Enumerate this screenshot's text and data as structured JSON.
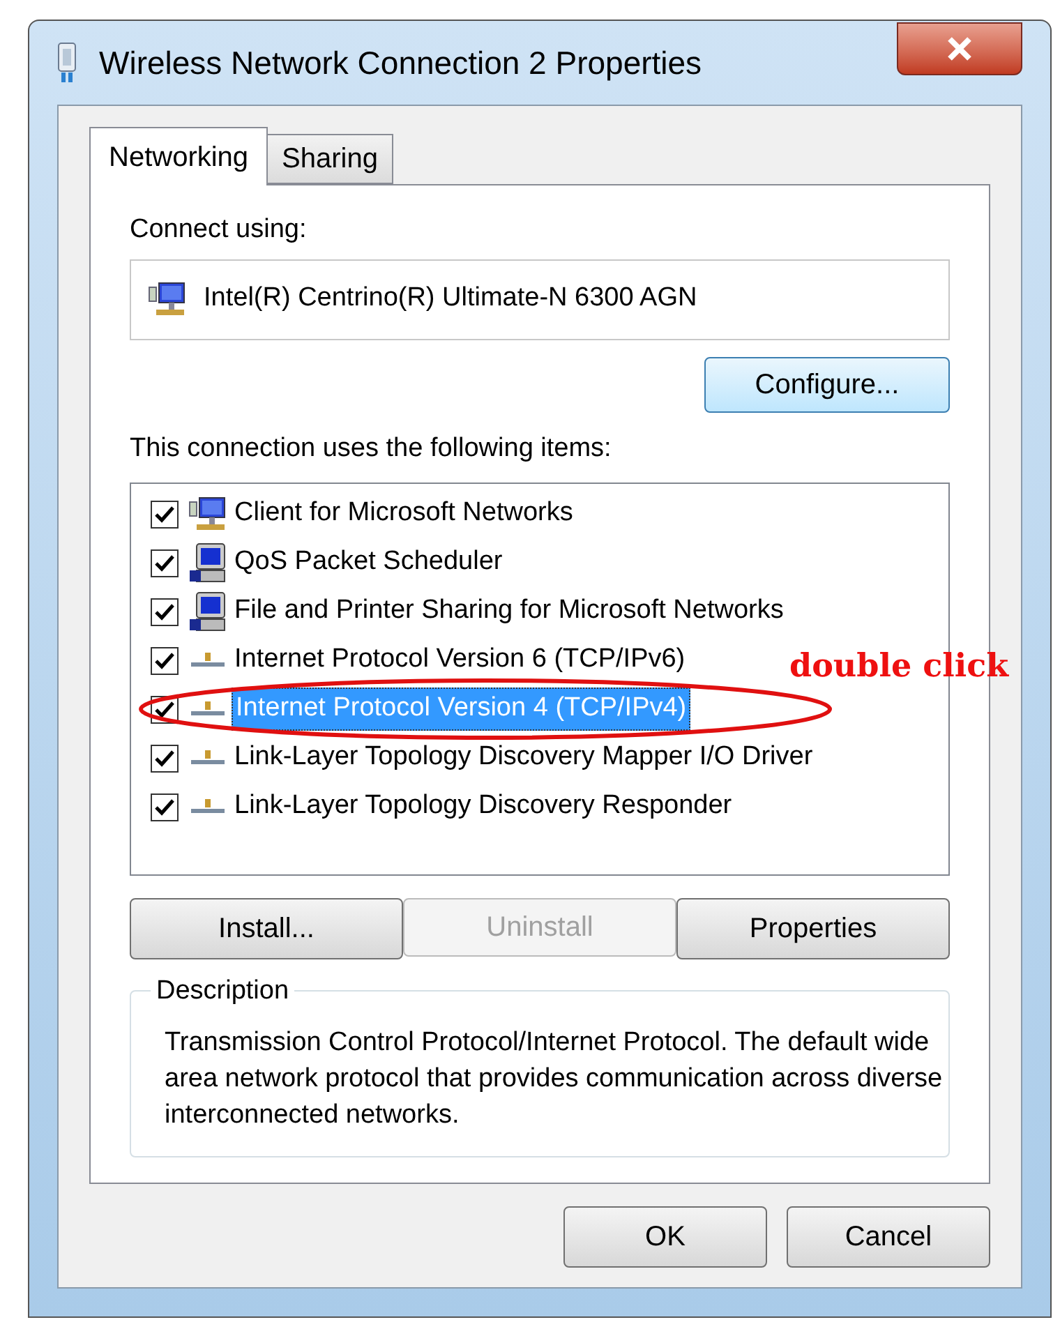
{
  "window": {
    "title": "Wireless Network Connection 2 Properties"
  },
  "tabs": [
    {
      "label": "Networking",
      "selected": true
    },
    {
      "label": "Sharing",
      "selected": false
    }
  ],
  "connect_using": {
    "label": "Connect using:",
    "adapter": "Intel(R) Centrino(R) Ultimate-N 6300 AGN",
    "configure_button": "Configure..."
  },
  "items_label": "This connection uses the following items:",
  "items": [
    {
      "kind": "client",
      "label": "Client for Microsoft Networks",
      "checked": true,
      "selected": false
    },
    {
      "kind": "service",
      "label": "QoS Packet Scheduler",
      "checked": true,
      "selected": false
    },
    {
      "kind": "service",
      "label": "File and Printer Sharing for Microsoft Networks",
      "checked": true,
      "selected": false
    },
    {
      "kind": "protocol",
      "label": "Internet Protocol Version 6 (TCP/IPv6)",
      "checked": true,
      "selected": false
    },
    {
      "kind": "protocol",
      "label": "Internet Protocol Version 4 (TCP/IPv4)",
      "checked": true,
      "selected": true
    },
    {
      "kind": "protocol",
      "label": "Link-Layer Topology Discovery Mapper I/O Driver",
      "checked": true,
      "selected": false
    },
    {
      "kind": "protocol",
      "label": "Link-Layer Topology Discovery Responder",
      "checked": true,
      "selected": false
    }
  ],
  "annotation": {
    "text": "double click"
  },
  "item_buttons": [
    {
      "label": "Install...",
      "disabled": false
    },
    {
      "label": "Uninstall",
      "disabled": true
    },
    {
      "label": "Properties",
      "disabled": false
    }
  ],
  "description": {
    "title": "Description",
    "text": "Transmission Control Protocol/Internet Protocol. The default wide area network protocol that provides communication across diverse interconnected networks."
  },
  "dialog_buttons": [
    "OK",
    "Cancel"
  ]
}
